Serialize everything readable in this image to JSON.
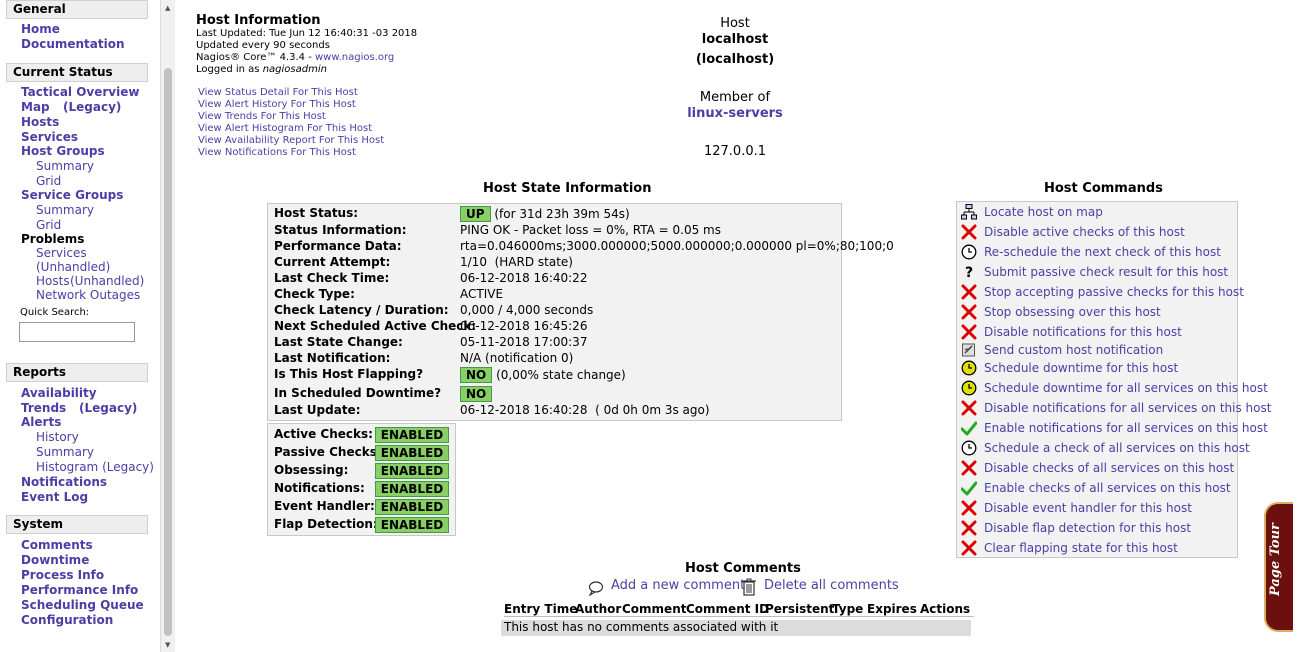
{
  "sidebar": {
    "general": "General",
    "home": "Home",
    "documentation": "Documentation",
    "current_status": "Current Status",
    "tactical_overview": "Tactical Overview",
    "map": "Map",
    "map_legacy": "(Legacy)",
    "hosts": "Hosts",
    "services": "Services",
    "host_groups": "Host Groups",
    "hg_summary": "Summary",
    "hg_grid": "Grid",
    "service_groups": "Service Groups",
    "sg_summary": "Summary",
    "sg_grid": "Grid",
    "problems": "Problems",
    "p_services": "Services",
    "p_services_unhandled": "(Unhandled)",
    "p_hosts": "Hosts",
    "p_hosts_unhandled": "(Unhandled)",
    "p_network_outages": "Network Outages",
    "quick_search": "Quick Search:",
    "reports": "Reports",
    "availability": "Availability",
    "trends": "Trends",
    "trends_legacy": "(Legacy)",
    "alerts": "Alerts",
    "a_history": "History",
    "a_summary": "Summary",
    "a_histogram": "Histogram (Legacy)",
    "notifications": "Notifications",
    "event_log": "Event Log",
    "system": "System",
    "comments": "Comments",
    "downtime": "Downtime",
    "process_info": "Process Info",
    "performance_info": "Performance Info",
    "scheduling_queue": "Scheduling Queue",
    "configuration": "Configuration"
  },
  "host_info": {
    "title": "Host Information",
    "last_updated": "Last Updated: Tue Jun 12 16:40:31 -03 2018",
    "update_interval": "Updated every 90 seconds",
    "core_prefix": "Nagios® Core™ 4.3.4 - ",
    "core_link": "www.nagios.org",
    "logged_prefix": "Logged in as ",
    "logged_user": "nagiosadmin",
    "links": [
      "View Status Detail For This Host",
      "View Alert History For This Host",
      "View Trends For This Host",
      "View Alert Histogram For This Host",
      "View Availability Report For This Host",
      "View Notifications For This Host"
    ]
  },
  "host": {
    "label": "Host",
    "name": "localhost",
    "alias": "(localhost)",
    "member_of": "Member of",
    "group": "linux-servers",
    "address": "127.0.0.1"
  },
  "state": {
    "title": "Host State Information",
    "rows": [
      {
        "k": "Host Status:",
        "badge": "UP",
        "v": " (for 31d 23h 39m 54s)"
      },
      {
        "k": "Status Information:",
        "v": "PING OK - Packet loss = 0%, RTA = 0.05 ms"
      },
      {
        "k": "Performance Data:",
        "v": "rta=0.046000ms;3000.000000;5000.000000;0.000000 pl=0%;80;100;0"
      },
      {
        "k": "Current Attempt:",
        "v": "1/10  (HARD state)"
      },
      {
        "k": "Last Check Time:",
        "v": "06-12-2018 16:40:22"
      },
      {
        "k": "Check Type:",
        "v": "ACTIVE"
      },
      {
        "k": "Check Latency / Duration:",
        "v": "0,000 / 4,000 seconds"
      },
      {
        "k": "Next Scheduled Active Check:",
        "v": "06-12-2018 16:45:26"
      },
      {
        "k": "Last State Change:",
        "v": "05-11-2018 17:00:37"
      },
      {
        "k": "Last Notification:",
        "v": "N/A (notification 0)"
      },
      {
        "k": "Is This Host Flapping?",
        "badge": "NO",
        "v": " (0,00% state change)"
      },
      {
        "k": "In Scheduled Downtime?",
        "badge": "NO",
        "v": ""
      },
      {
        "k": "Last Update:",
        "v": "06-12-2018 16:40:28  ( 0d 0h 0m 3s ago)"
      }
    ],
    "checks": [
      {
        "k": "Active Checks:",
        "v": "ENABLED"
      },
      {
        "k": "Passive Checks:",
        "v": "ENABLED"
      },
      {
        "k": "Obsessing:",
        "v": "ENABLED"
      },
      {
        "k": "Notifications:",
        "v": "ENABLED"
      },
      {
        "k": "Event Handler:",
        "v": "ENABLED"
      },
      {
        "k": "Flap Detection:",
        "v": "ENABLED"
      }
    ],
    "badge_color": "#88d066"
  },
  "commands": {
    "title": "Host Commands",
    "items": [
      {
        "icon": "network-map-icon",
        "label": "Locate host on map"
      },
      {
        "icon": "disable-x-icon",
        "label": "Disable active checks of this host"
      },
      {
        "icon": "clock-icon",
        "label": "Re-schedule the next check of this host"
      },
      {
        "icon": "question-icon",
        "label": "Submit passive check result for this host"
      },
      {
        "icon": "disable-x-icon",
        "label": "Stop accepting passive checks for this host"
      },
      {
        "icon": "disable-x-icon",
        "label": "Stop obsessing over this host"
      },
      {
        "icon": "disable-x-icon",
        "label": "Disable notifications for this host"
      },
      {
        "icon": "notify-icon",
        "label": "Send custom host notification"
      },
      {
        "icon": "downtime-clock-icon",
        "label": "Schedule downtime for this host"
      },
      {
        "icon": "downtime-clock-icon",
        "label": "Schedule downtime for all services on this host"
      },
      {
        "icon": "disable-x-icon",
        "label": "Disable notifications for all services on this host"
      },
      {
        "icon": "enable-check-icon",
        "label": "Enable notifications for all services on this host"
      },
      {
        "icon": "clock-icon",
        "label": "Schedule a check of all services on this host"
      },
      {
        "icon": "disable-x-icon",
        "label": "Disable checks of all services on this host"
      },
      {
        "icon": "enable-check-icon",
        "label": "Enable checks of all services on this host"
      },
      {
        "icon": "disable-x-icon",
        "label": "Disable event handler for this host"
      },
      {
        "icon": "disable-x-icon",
        "label": "Disable flap detection for this host"
      },
      {
        "icon": "disable-x-icon",
        "label": "Clear flapping state for this host"
      }
    ]
  },
  "comments": {
    "title": "Host Comments",
    "add": "Add a new comment",
    "delete": "Delete all comments",
    "headers": [
      "Entry Time",
      "Author",
      "Comment",
      "Comment ID",
      "Persistent",
      "Type",
      "Expires",
      "Actions"
    ],
    "empty": "This host has no comments associated with it"
  },
  "page_tour": "Page Tour",
  "colors": {
    "link": "#4b3fa5",
    "disable": "#dd0000",
    "enable": "#22aa22",
    "downtime": "#e0e000",
    "tour": "#6b0f0f"
  }
}
